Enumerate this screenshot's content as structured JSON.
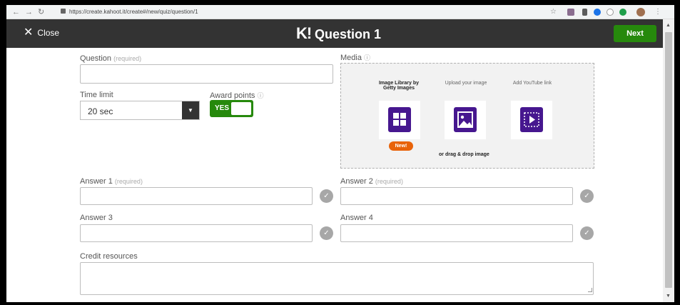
{
  "browser": {
    "url": "https://create.kahoot.it/create#/new/quiz/question/1",
    "back_icon": "arrow-left-icon",
    "forward_icon": "arrow-right-icon",
    "reload_icon": "reload-icon"
  },
  "header": {
    "close_label": "Close",
    "logo": "K!",
    "title": "Question 1",
    "next_label": "Next"
  },
  "form": {
    "question": {
      "label": "Question",
      "required": "(required)",
      "value": ""
    },
    "time_limit": {
      "label": "Time limit",
      "value": "20 sec"
    },
    "award_points": {
      "label": "Award points",
      "value": "YES"
    },
    "media": {
      "label": "Media",
      "options": [
        {
          "label": "Image Library by Getty Images",
          "icon": "image-library-icon"
        },
        {
          "label": "Upload your image",
          "icon": "upload-image-icon"
        },
        {
          "label": "Add YouTube link",
          "icon": "youtube-video-icon"
        }
      ],
      "badge": "New!",
      "drag_text": "or drag & drop image"
    },
    "answers": [
      {
        "label": "Answer 1",
        "required": "(required)",
        "value": ""
      },
      {
        "label": "Answer 2",
        "required": "(required)",
        "value": ""
      },
      {
        "label": "Answer 3",
        "required": "",
        "value": ""
      },
      {
        "label": "Answer 4",
        "required": "",
        "value": ""
      }
    ],
    "credit": {
      "label": "Credit resources",
      "value": ""
    }
  },
  "colors": {
    "header_bg": "#333333",
    "next_green": "#26890c",
    "media_purple": "#46178f",
    "badge_orange": "#e8630a"
  }
}
